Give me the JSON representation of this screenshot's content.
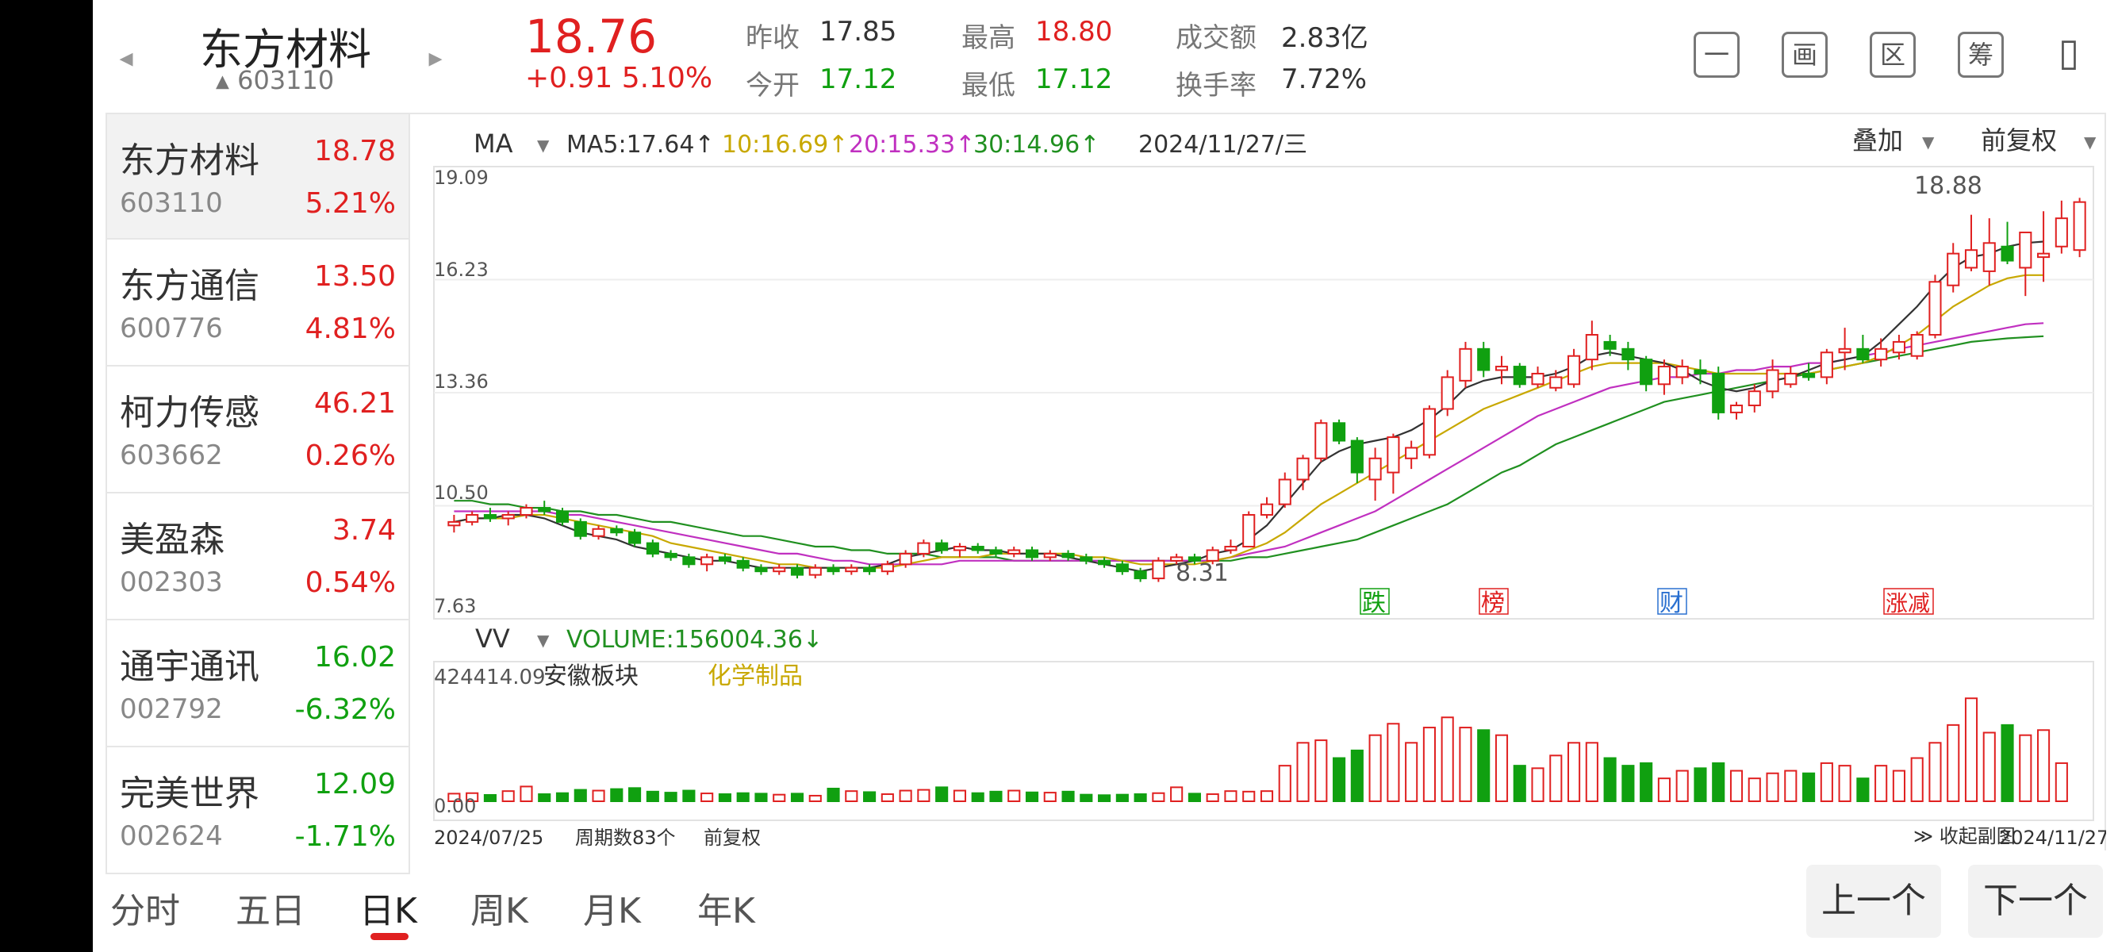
{
  "header": {
    "prev_arrow": "◂",
    "next_arrow": "▸",
    "name": "东方材料",
    "code": "603110",
    "code_marker": "▲",
    "price": "18.76",
    "change": "+0.91  5.10%",
    "quotes": [
      {
        "label": "昨收",
        "value": "17.85",
        "color": "#333333"
      },
      {
        "label": "今开",
        "value": "17.12",
        "color": "#10a010"
      },
      {
        "label": "最高",
        "value": "18.80",
        "color": "#e02020"
      },
      {
        "label": "最低",
        "value": "17.12",
        "color": "#10a010"
      },
      {
        "label": "成交额",
        "value": "2.83亿",
        "color": "#333333"
      },
      {
        "label": "换手率",
        "value": "7.72%",
        "color": "#333333"
      }
    ],
    "tools": [
      "一",
      "画",
      "区",
      "筹",
      "▯"
    ]
  },
  "sidebar": [
    {
      "name": "东方材料",
      "code": "603110",
      "price": "18.78",
      "pct": "5.21%",
      "color": "#e02020"
    },
    {
      "name": "东方通信",
      "code": "600776",
      "price": "13.50",
      "pct": "4.81%",
      "color": "#e02020"
    },
    {
      "name": "柯力传感",
      "code": "603662",
      "price": "46.21",
      "pct": "0.26%",
      "color": "#e02020"
    },
    {
      "name": "美盈森",
      "code": "002303",
      "price": "3.74",
      "pct": "0.54%",
      "color": "#e02020"
    },
    {
      "name": "通宇通讯",
      "code": "002792",
      "price": "16.02",
      "pct": "-6.32%",
      "color": "#10a010"
    },
    {
      "name": "完美世界",
      "code": "002624",
      "price": "12.09",
      "pct": "-1.71%",
      "color": "#10a010"
    }
  ],
  "chart": {
    "ma_label": "MA",
    "ma5": "MA5:17.64↑",
    "ma10": "10:16.69↑",
    "ma20": "20:15.33↑",
    "ma30": "30:14.96↑",
    "date": "2024/11/27/三",
    "overlay_label": "叠加",
    "adjust_label": "前复权",
    "y_ticks": [
      "19.09",
      "16.23",
      "13.36",
      "10.50",
      "7.63"
    ],
    "high_label": "18.88",
    "low_label": "8.31",
    "markers": [
      {
        "text": "跌",
        "color": "#10a010"
      },
      {
        "text": "榜",
        "color": "#e02020"
      },
      {
        "text": "财",
        "color": "#2a70d0"
      },
      {
        "text": "涨减",
        "color": "#e02020"
      }
    ],
    "vol_label": "VV",
    "vol_value": "VOLUME:156004.36↓",
    "vol_max": "424414.09",
    "vol_zero": "0.00",
    "sector_1": "安徽板块",
    "sector_2": "化学制品",
    "date_start": "2024/07/25",
    "period_count": "周期数83个",
    "adjust_bottom": "前复权",
    "collapse_label": "收起副图",
    "date_end": "2024/11/27",
    "colors": {
      "up": "#e02020",
      "down": "#10a010",
      "ma5": "#333333",
      "ma10": "#c8a800",
      "ma20": "#c030c0",
      "ma30": "#209020"
    }
  },
  "chart_data": {
    "type": "candlestick",
    "y_range": [
      7.63,
      19.09
    ],
    "candles": [
      [
        9.6,
        9.9,
        9.4,
        9.7
      ],
      [
        9.7,
        10.0,
        9.6,
        9.9
      ],
      [
        9.9,
        10.1,
        9.7,
        9.8
      ],
      [
        9.8,
        10.0,
        9.6,
        9.9
      ],
      [
        9.9,
        10.2,
        9.8,
        10.1
      ],
      [
        10.1,
        10.3,
        9.9,
        10.0
      ],
      [
        10.0,
        10.1,
        9.6,
        9.7
      ],
      [
        9.7,
        9.8,
        9.2,
        9.3
      ],
      [
        9.3,
        9.6,
        9.2,
        9.5
      ],
      [
        9.5,
        9.6,
        9.3,
        9.4
      ],
      [
        9.4,
        9.5,
        9.0,
        9.1
      ],
      [
        9.1,
        9.2,
        8.7,
        8.8
      ],
      [
        8.8,
        8.9,
        8.6,
        8.7
      ],
      [
        8.7,
        8.8,
        8.4,
        8.5
      ],
      [
        8.5,
        8.8,
        8.3,
        8.7
      ],
      [
        8.7,
        8.8,
        8.5,
        8.6
      ],
      [
        8.6,
        8.7,
        8.3,
        8.4
      ],
      [
        8.4,
        8.5,
        8.2,
        8.3
      ],
      [
        8.3,
        8.5,
        8.2,
        8.4
      ],
      [
        8.4,
        8.5,
        8.1,
        8.2
      ],
      [
        8.2,
        8.5,
        8.1,
        8.4
      ],
      [
        8.4,
        8.5,
        8.2,
        8.3
      ],
      [
        8.3,
        8.5,
        8.2,
        8.4
      ],
      [
        8.4,
        8.5,
        8.2,
        8.3
      ],
      [
        8.3,
        8.6,
        8.2,
        8.5
      ],
      [
        8.5,
        8.9,
        8.4,
        8.8
      ],
      [
        8.8,
        9.2,
        8.7,
        9.1
      ],
      [
        9.1,
        9.2,
        8.8,
        8.9
      ],
      [
        8.9,
        9.1,
        8.7,
        9.0
      ],
      [
        9.0,
        9.1,
        8.8,
        8.9
      ],
      [
        8.9,
        9.0,
        8.7,
        8.8
      ],
      [
        8.8,
        9.0,
        8.7,
        8.9
      ],
      [
        8.9,
        9.0,
        8.6,
        8.7
      ],
      [
        8.7,
        8.9,
        8.6,
        8.8
      ],
      [
        8.8,
        8.9,
        8.6,
        8.7
      ],
      [
        8.7,
        8.8,
        8.5,
        8.6
      ],
      [
        8.6,
        8.7,
        8.4,
        8.5
      ],
      [
        8.5,
        8.6,
        8.2,
        8.3
      ],
      [
        8.3,
        8.4,
        8.0,
        8.1
      ],
      [
        8.1,
        8.7,
        8.0,
        8.6
      ],
      [
        8.6,
        8.8,
        8.5,
        8.7
      ],
      [
        8.7,
        8.8,
        8.5,
        8.6
      ],
      [
        8.6,
        9.0,
        8.5,
        8.9
      ],
      [
        8.9,
        9.2,
        8.8,
        9.0
      ],
      [
        9.0,
        10.0,
        9.0,
        9.9
      ],
      [
        9.9,
        10.4,
        9.8,
        10.2
      ],
      [
        10.2,
        11.1,
        10.1,
        10.9
      ],
      [
        10.9,
        11.6,
        10.6,
        11.5
      ],
      [
        11.5,
        12.6,
        11.4,
        12.5
      ],
      [
        12.5,
        12.6,
        11.9,
        12.0
      ],
      [
        12.0,
        12.1,
        10.8,
        11.1
      ],
      [
        10.9,
        11.8,
        10.3,
        11.5
      ],
      [
        11.1,
        12.2,
        10.5,
        12.1
      ],
      [
        11.5,
        12.0,
        11.2,
        11.8
      ],
      [
        11.6,
        13.0,
        11.5,
        12.9
      ],
      [
        12.9,
        14.0,
        12.7,
        13.8
      ],
      [
        13.7,
        14.8,
        13.5,
        14.6
      ],
      [
        14.6,
        14.8,
        13.8,
        14.0
      ],
      [
        14.0,
        14.4,
        13.6,
        14.1
      ],
      [
        14.1,
        14.2,
        13.5,
        13.6
      ],
      [
        13.6,
        14.1,
        13.5,
        13.9
      ],
      [
        13.5,
        14.0,
        13.4,
        13.8
      ],
      [
        13.6,
        14.6,
        13.5,
        14.4
      ],
      [
        14.3,
        15.4,
        14.0,
        15.0
      ],
      [
        14.8,
        15.0,
        14.4,
        14.6
      ],
      [
        14.6,
        14.8,
        14.0,
        14.3
      ],
      [
        14.3,
        14.4,
        13.4,
        13.6
      ],
      [
        13.6,
        14.3,
        13.3,
        14.1
      ],
      [
        13.8,
        14.3,
        13.6,
        14.1
      ],
      [
        14.0,
        14.3,
        13.6,
        13.9
      ],
      [
        13.9,
        14.1,
        12.6,
        12.8
      ],
      [
        12.8,
        13.1,
        12.6,
        13.0
      ],
      [
        13.0,
        13.6,
        12.8,
        13.4
      ],
      [
        13.4,
        14.3,
        13.2,
        14.0
      ],
      [
        13.6,
        14.1,
        13.5,
        13.9
      ],
      [
        13.9,
        14.2,
        13.7,
        13.8
      ],
      [
        13.8,
        14.6,
        13.6,
        14.5
      ],
      [
        14.5,
        15.2,
        14.0,
        14.6
      ],
      [
        14.6,
        15.0,
        14.2,
        14.3
      ],
      [
        14.3,
        14.9,
        14.1,
        14.6
      ],
      [
        14.5,
        15.0,
        14.3,
        14.8
      ],
      [
        14.4,
        15.1,
        14.3,
        15.0
      ],
      [
        15.0,
        16.7,
        14.9,
        16.5
      ],
      [
        16.4,
        17.6,
        16.2,
        17.3
      ],
      [
        16.9,
        18.4,
        16.8,
        17.4
      ],
      [
        16.8,
        18.3,
        16.4,
        17.6
      ],
      [
        17.5,
        18.2,
        17.0,
        17.1
      ],
      [
        16.9,
        17.8,
        16.1,
        17.9
      ],
      [
        17.2,
        18.5,
        16.5,
        17.3
      ],
      [
        17.5,
        18.8,
        17.3,
        18.3
      ],
      [
        17.4,
        18.88,
        17.2,
        18.76
      ]
    ],
    "ma5": [
      9.7,
      9.8,
      9.8,
      9.9,
      9.9,
      9.8,
      9.6,
      9.4,
      9.3,
      9.2,
      9.0,
      8.9,
      8.8,
      8.7,
      8.6,
      8.6,
      8.5,
      8.4,
      8.4,
      8.4,
      8.4,
      8.4,
      8.4,
      8.4,
      8.5,
      8.7,
      8.8,
      8.9,
      9.0,
      8.9,
      8.9,
      8.8,
      8.8,
      8.8,
      8.7,
      8.6,
      8.5,
      8.4,
      8.3,
      8.4,
      8.5,
      8.6,
      8.8,
      8.9,
      9.2,
      9.6,
      10.2,
      10.8,
      11.4,
      11.7,
      11.9,
      12.0,
      12.1,
      12.3,
      12.6,
      13.0,
      13.5,
      13.7,
      13.8,
      13.8,
      13.8,
      13.9,
      14.1,
      14.4,
      14.5,
      14.4,
      14.3,
      14.2,
      14.0,
      13.7,
      13.5,
      13.4,
      13.5,
      13.7,
      13.8,
      14.0,
      14.2,
      14.3,
      14.4,
      14.8,
      15.3,
      15.8,
      16.4,
      16.9,
      17.2,
      17.3,
      17.5,
      17.6,
      17.64
    ],
    "ma10": [
      9.7,
      9.8,
      9.8,
      9.8,
      9.9,
      9.9,
      9.8,
      9.7,
      9.6,
      9.5,
      9.4,
      9.3,
      9.1,
      9.0,
      8.9,
      8.8,
      8.7,
      8.6,
      8.5,
      8.5,
      8.4,
      8.4,
      8.4,
      8.4,
      8.4,
      8.5,
      8.6,
      8.7,
      8.7,
      8.7,
      8.8,
      8.8,
      8.8,
      8.8,
      8.8,
      8.7,
      8.7,
      8.6,
      8.5,
      8.5,
      8.5,
      8.5,
      8.6,
      8.7,
      8.9,
      9.1,
      9.4,
      9.8,
      10.2,
      10.5,
      10.8,
      11.1,
      11.4,
      11.7,
      12.0,
      12.3,
      12.6,
      12.9,
      13.1,
      13.3,
      13.5,
      13.7,
      13.9,
      14.1,
      14.2,
      14.2,
      14.2,
      14.2,
      14.1,
      14.0,
      13.9,
      13.9,
      13.9,
      13.9,
      13.9,
      13.9,
      14.0,
      14.1,
      14.2,
      14.4,
      14.7,
      15.0,
      15.4,
      15.8,
      16.1,
      16.4,
      16.6,
      16.69,
      16.69
    ],
    "ma20": [
      10.0,
      10.0,
      10.0,
      10.0,
      10.0,
      10.0,
      9.9,
      9.9,
      9.8,
      9.7,
      9.6,
      9.5,
      9.4,
      9.3,
      9.2,
      9.1,
      9.0,
      8.9,
      8.8,
      8.8,
      8.7,
      8.6,
      8.6,
      8.5,
      8.5,
      8.5,
      8.5,
      8.5,
      8.6,
      8.6,
      8.6,
      8.6,
      8.6,
      8.6,
      8.6,
      8.6,
      8.6,
      8.6,
      8.6,
      8.6,
      8.6,
      8.6,
      8.6,
      8.7,
      8.8,
      8.9,
      9.0,
      9.2,
      9.4,
      9.6,
      9.8,
      10.0,
      10.3,
      10.6,
      10.9,
      11.2,
      11.5,
      11.8,
      12.1,
      12.4,
      12.7,
      12.9,
      13.1,
      13.3,
      13.5,
      13.6,
      13.7,
      13.8,
      13.8,
      13.9,
      13.9,
      14.0,
      14.0,
      14.1,
      14.1,
      14.2,
      14.2,
      14.3,
      14.4,
      14.5,
      14.6,
      14.7,
      14.8,
      14.9,
      15.0,
      15.1,
      15.2,
      15.3,
      15.33
    ],
    "ma30": [
      10.3,
      10.3,
      10.2,
      10.2,
      10.1,
      10.1,
      10.0,
      10.0,
      9.9,
      9.9,
      9.8,
      9.7,
      9.7,
      9.6,
      9.5,
      9.4,
      9.3,
      9.3,
      9.2,
      9.1,
      9.0,
      9.0,
      8.9,
      8.9,
      8.8,
      8.8,
      8.8,
      8.7,
      8.7,
      8.7,
      8.7,
      8.6,
      8.6,
      8.6,
      8.6,
      8.6,
      8.6,
      8.6,
      8.6,
      8.6,
      8.6,
      8.6,
      8.6,
      8.6,
      8.7,
      8.7,
      8.8,
      8.9,
      9.0,
      9.1,
      9.2,
      9.4,
      9.6,
      9.8,
      10.0,
      10.2,
      10.5,
      10.8,
      11.1,
      11.3,
      11.6,
      11.9,
      12.1,
      12.3,
      12.5,
      12.7,
      12.9,
      13.1,
      13.2,
      13.3,
      13.4,
      13.5,
      13.6,
      13.7,
      13.8,
      13.9,
      14.0,
      14.1,
      14.2,
      14.3,
      14.4,
      14.5,
      14.6,
      14.7,
      14.8,
      14.85,
      14.9,
      14.93,
      14.96
    ],
    "volume_range": [
      0,
      424414.09
    ],
    "volumes": [
      30000,
      32000,
      25000,
      40000,
      58000,
      28000,
      32000,
      45000,
      42000,
      48000,
      52000,
      38000,
      34000,
      42000,
      31000,
      28000,
      32000,
      30000,
      26000,
      30000,
      22000,
      50000,
      40000,
      36000,
      28000,
      42000,
      45000,
      55000,
      42000,
      32000,
      38000,
      42000,
      35000,
      34000,
      38000,
      26000,
      24000,
      26000,
      28000,
      32000,
      55000,
      30000,
      28000,
      40000,
      38000,
      40000,
      140000,
      230000,
      240000,
      170000,
      200000,
      260000,
      305000,
      230000,
      290000,
      330000,
      290000,
      280000,
      260000,
      140000,
      130000,
      180000,
      230000,
      230000,
      170000,
      140000,
      150000,
      90000,
      120000,
      130000,
      150000,
      120000,
      90000,
      110000,
      120000,
      110000,
      150000,
      140000,
      90000,
      140000,
      120000,
      170000,
      230000,
      300000,
      405000,
      270000,
      300000,
      260000,
      280000,
      150000
    ]
  }
}
